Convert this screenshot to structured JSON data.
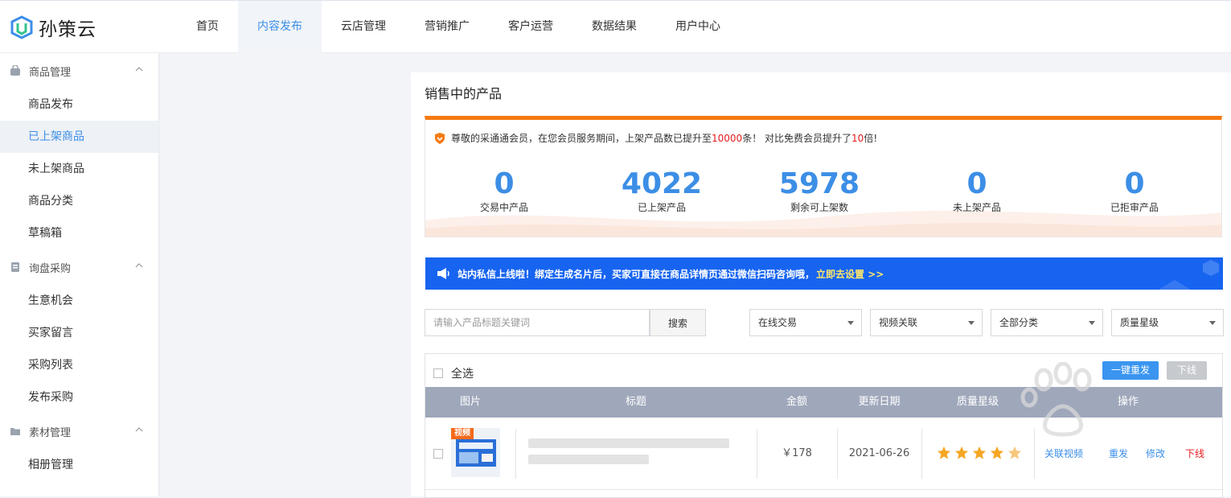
{
  "app": {
    "name": "孙策云"
  },
  "nav": {
    "items": [
      {
        "label": "首页",
        "active": false
      },
      {
        "label": "内容发布",
        "active": true
      },
      {
        "label": "云店管理",
        "active": false
      },
      {
        "label": "营销推广",
        "active": false
      },
      {
        "label": "客户运营",
        "active": false
      },
      {
        "label": "数据结果",
        "active": false
      },
      {
        "label": "用户中心",
        "active": false
      }
    ]
  },
  "sidebar": {
    "groups": [
      {
        "title": "商品管理",
        "items": [
          "商品发布",
          "已上架商品",
          "未上架商品",
          "商品分类",
          "草稿箱"
        ]
      },
      {
        "title": "询盘采购",
        "items": [
          "生意机会",
          "买家留言",
          "采购列表",
          "发布采购"
        ]
      },
      {
        "title": "素材管理",
        "items": [
          "相册管理"
        ]
      }
    ],
    "active_item": "已上架商品"
  },
  "main": {
    "title": "销售中的产品",
    "notice": {
      "prefix": "尊敬的采通通会员，在您会员服务期间，上架产品数已提升至",
      "limit": "10000",
      "middle": "条！ 对比免费会员提升了",
      "times": "10",
      "suffix": "倍!"
    },
    "stats": [
      {
        "value": "0",
        "label": "交易中产品"
      },
      {
        "value": "4022",
        "label": "已上架产品"
      },
      {
        "value": "5978",
        "label": "剩余可上架数"
      },
      {
        "value": "0",
        "label": "未上架产品"
      },
      {
        "value": "0",
        "label": "已拒审产品"
      }
    ],
    "banner": {
      "text": "站内私信上线啦！绑定生成名片后，买家可直接在商品详情页通过微信扫码咨询哦，",
      "link": "立即去设置 >>"
    },
    "search": {
      "placeholder": "请输入产品标题关键词",
      "button": "搜索"
    },
    "filters": [
      "在线交易",
      "视频关联",
      "全部分类",
      "质量星级"
    ],
    "toolbar": {
      "select_all": "全选",
      "republish": "一键重发",
      "offline": "下线"
    },
    "table": {
      "headers": [
        "图片",
        "标题",
        "金额",
        "更新日期",
        "质量星级",
        "操作"
      ],
      "rows": [
        {
          "tag": "视频",
          "price": "￥178",
          "date": "2021-06-26",
          "stars": 4,
          "actions": [
            "关联视频",
            "重发",
            "修改",
            "下线"
          ]
        }
      ]
    }
  },
  "colors": {
    "accent": "#3b8ee8",
    "orange": "#f47a12",
    "banner": "#1764f0",
    "danger": "#e5191c",
    "star": "#f5a623"
  }
}
